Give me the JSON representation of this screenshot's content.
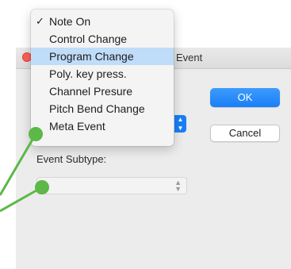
{
  "dialog": {
    "title_partial": "Event",
    "ok_label": "OK",
    "cancel_label": "Cancel",
    "subtype_label": "Event Subtype:",
    "accent_color": "#1a7ff6"
  },
  "menu": {
    "items": [
      {
        "label": "Note On",
        "checked": true
      },
      {
        "label": "Control Change"
      },
      {
        "label": "Program Change",
        "highlighted": true
      },
      {
        "label": "Poly. key press."
      },
      {
        "label": "Channel Presure"
      },
      {
        "label": "Pitch Bend Change"
      },
      {
        "label": "Meta Event"
      }
    ],
    "check_glyph": "✓",
    "highlight_color": "#bfdcf8"
  },
  "callout_color": "#5cb847"
}
